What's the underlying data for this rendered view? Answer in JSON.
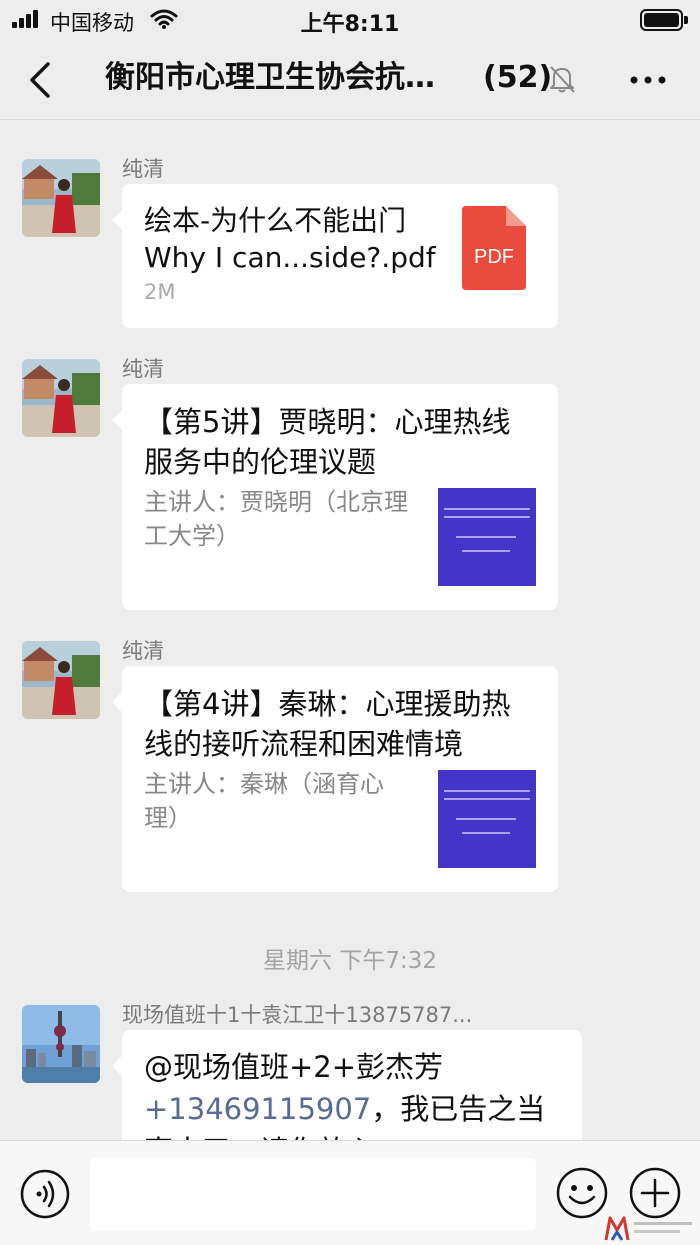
{
  "status_bar": {
    "carrier": "中国移动",
    "time": "上午8:11"
  },
  "nav": {
    "title": "衡阳市心理卫生协会抗…",
    "member_count": "(52)",
    "icons": [
      "back-chevron-icon",
      "mute-bell-icon",
      "more-dots-icon"
    ]
  },
  "messages": [
    {
      "type": "file",
      "sender": "纯清",
      "file_name": "绘本-为什么不能出门 Why I can...side?.pdf",
      "file_size": "2M",
      "file_badge": "PDF"
    },
    {
      "type": "link",
      "sender": "纯清",
      "title": "【第5讲】贾晓明：心理热线服务中的伦理议题",
      "description": "主讲人：贾晓明（北京理工大学）"
    },
    {
      "type": "link",
      "sender": "纯清",
      "title": "【第4讲】秦琳：心理援助热线的接听流程和困难情境",
      "description": "主讲人：秦琳（涵育心理）"
    },
    {
      "type": "divider",
      "text": "星期六 下午7:32"
    },
    {
      "type": "text",
      "sender": "现场值班十1十袁江卫十13875787...",
      "line1": "@现场值班+2+彭杰芳",
      "phone": "+13469115907",
      "line2_rest": "，我已告之当",
      "line3": "事人了，请你放心"
    }
  ],
  "input_bar": {
    "placeholder": "",
    "icons": [
      "voice-icon",
      "emoji-icon",
      "plus-icon"
    ]
  },
  "colors": {
    "background": "#ededed",
    "bubble": "#ffffff",
    "link": "#576b95",
    "pdf_red": "#e94b3c",
    "thumb_purple": "#4534c8"
  }
}
